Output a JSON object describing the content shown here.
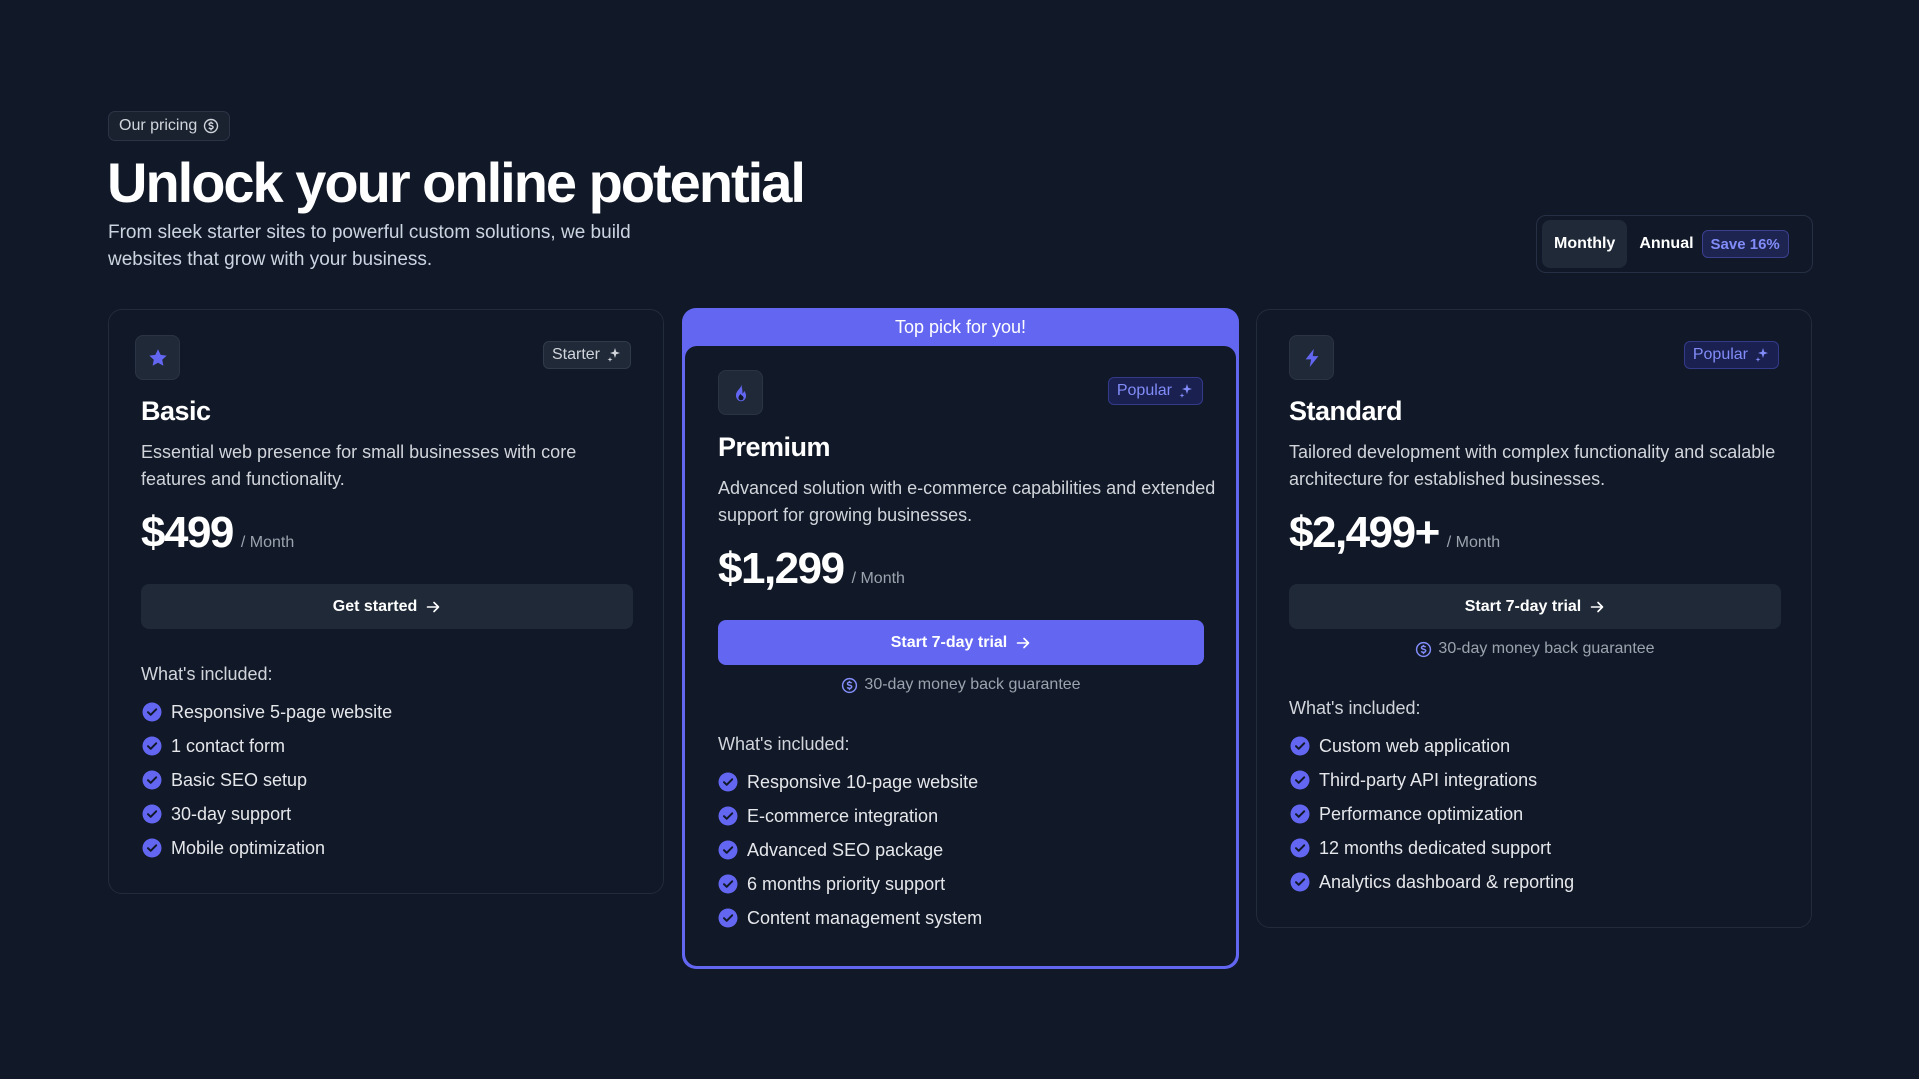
{
  "header": {
    "eyebrow": "Our pricing",
    "title": "Unlock your online potential",
    "subtitle": "From sleek starter sites to powerful custom solutions, we build websites that grow with your business."
  },
  "billing": {
    "monthly": "Monthly",
    "annual": "Annual",
    "save": "Save 16%",
    "selected": "Monthly"
  },
  "plans": [
    {
      "name": "Basic",
      "tag": "Starter",
      "icon": "star-icon",
      "description": "Essential web presence for small businesses with core features and functionality.",
      "price": "$499",
      "period": "/ Month",
      "cta": "Get started",
      "included_title": "What's included:",
      "features": [
        "Responsive 5-page website",
        "1 contact form",
        "Basic SEO setup",
        "30-day support",
        "Mobile optimization"
      ]
    },
    {
      "name": "Premium",
      "banner": "Top pick for you!",
      "tag": "Popular",
      "icon": "flame-icon",
      "description": "Advanced solution with e-commerce capabilities and extended support for growing businesses.",
      "price": "$1,299",
      "period": "/ Month",
      "cta": "Start 7-day trial",
      "guarantee": "30-day money back guarantee",
      "included_title": "What's included:",
      "features": [
        "Responsive 10-page website",
        "E-commerce integration",
        "Advanced SEO package",
        "6 months priority support",
        "Content management system"
      ]
    },
    {
      "name": "Standard",
      "tag": "Popular",
      "icon": "bolt-icon",
      "description": "Tailored development with complex functionality and scalable architecture for established businesses.",
      "price": "$2,499+",
      "period": "/ Month",
      "cta": "Start 7-day trial",
      "guarantee": "30-day money back guarantee",
      "included_title": "What's included:",
      "features": [
        "Custom web application",
        "Third-party API integrations",
        "Performance optimization",
        "12 months dedicated support",
        "Analytics dashboard & reporting"
      ]
    }
  ],
  "colors": {
    "background": "#111827",
    "accent": "#6366f1",
    "accent_text": "#818cf8",
    "card_border": "#232c3b"
  }
}
